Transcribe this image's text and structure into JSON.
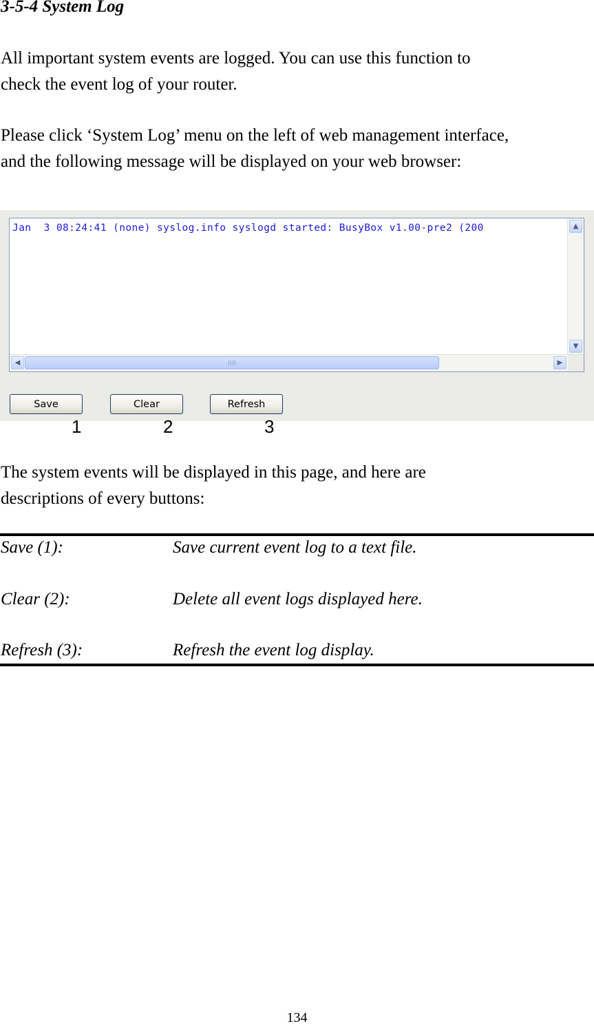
{
  "heading": "3-5-4 System Log",
  "intro": "All important system events are logged. You can use this function to\ncheck the event log of your router.",
  "instruction": "Please click ‘System Log’ menu on the left of web management interface,\nand the following message will be displayed on your web browser:",
  "screenshot": {
    "log_text": "Jan  3 08:24:41 (none) syslog.info syslogd started: BusyBox v1.00-pre2 (200",
    "buttons": {
      "save": "Save",
      "clear": "Clear",
      "refresh": "Refresh"
    },
    "callouts": [
      "1",
      "2",
      "3"
    ],
    "icons": {
      "scroll_up": "arrow-up-icon",
      "scroll_down": "arrow-down-icon",
      "scroll_left": "arrow-left-icon",
      "scroll_right": "arrow-right-icon"
    }
  },
  "description_intro": "The system events will be displayed in this page, and here are\ndescriptions of every buttons:",
  "descriptions": [
    {
      "term": "Save (1):",
      "text": "Save current event log to a text file."
    },
    {
      "term": "Clear (2):",
      "text": "Delete all event logs displayed here."
    },
    {
      "term": "Refresh (3):",
      "text": "Refresh the event log display."
    }
  ],
  "page_number": "134"
}
